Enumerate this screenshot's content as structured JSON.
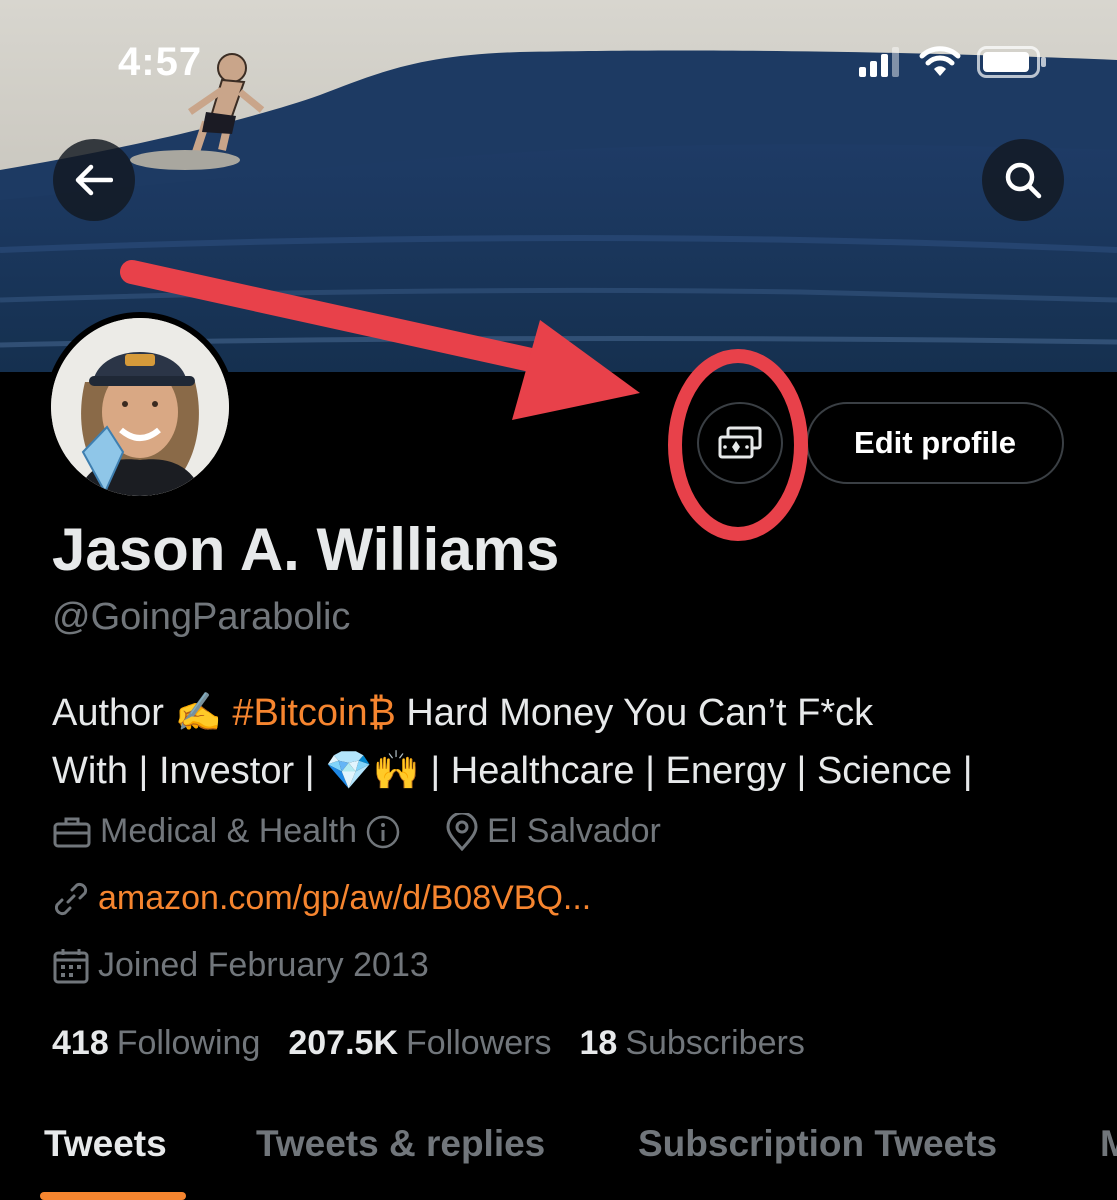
{
  "status_bar": {
    "time": "4:57",
    "icons": [
      "signal-icon",
      "wifi-icon",
      "battery-icon"
    ]
  },
  "header": {
    "back_icon": "arrow-left-icon",
    "search_icon": "search-icon"
  },
  "actions": {
    "subscriptions_icon": "money-icon",
    "edit_profile_label": "Edit profile"
  },
  "profile": {
    "name": "Jason A. Williams",
    "handle": "@GoingParabolic",
    "bio": {
      "part1": "Author",
      "emoji_writing": "✍️",
      "hashtag": "#Bitcoin",
      "emoji_bitcoin": "₿",
      "part2": "Hard Money You Can’t F*ck",
      "part3": "With | Investor |",
      "emoji_diamond": "💎",
      "emoji_hands": "🙌",
      "part4": "| Healthcare | Energy | Science |"
    },
    "category": "Medical & Health",
    "category_info_icon": "info-icon",
    "location": "El Salvador",
    "link": "amazon.com/gp/aw/d/B08VBQ...",
    "joined": "Joined February 2013"
  },
  "stats": {
    "following_count": "418",
    "following_label": "Following",
    "followers_count": "207.5K",
    "followers_label": "Followers",
    "subscribers_count": "18",
    "subscribers_label": "Subscribers"
  },
  "tabs": [
    {
      "label": "Tweets",
      "active": true
    },
    {
      "label": "Tweets & replies",
      "active": false
    },
    {
      "label": "Subscription Tweets",
      "active": false
    },
    {
      "label": "M",
      "active": false
    }
  ],
  "colors": {
    "accent": "#f6852f",
    "background": "#000000",
    "primary_text": "#e7e9ea",
    "secondary_text": "#71767b",
    "annotation": "#e8414a"
  }
}
